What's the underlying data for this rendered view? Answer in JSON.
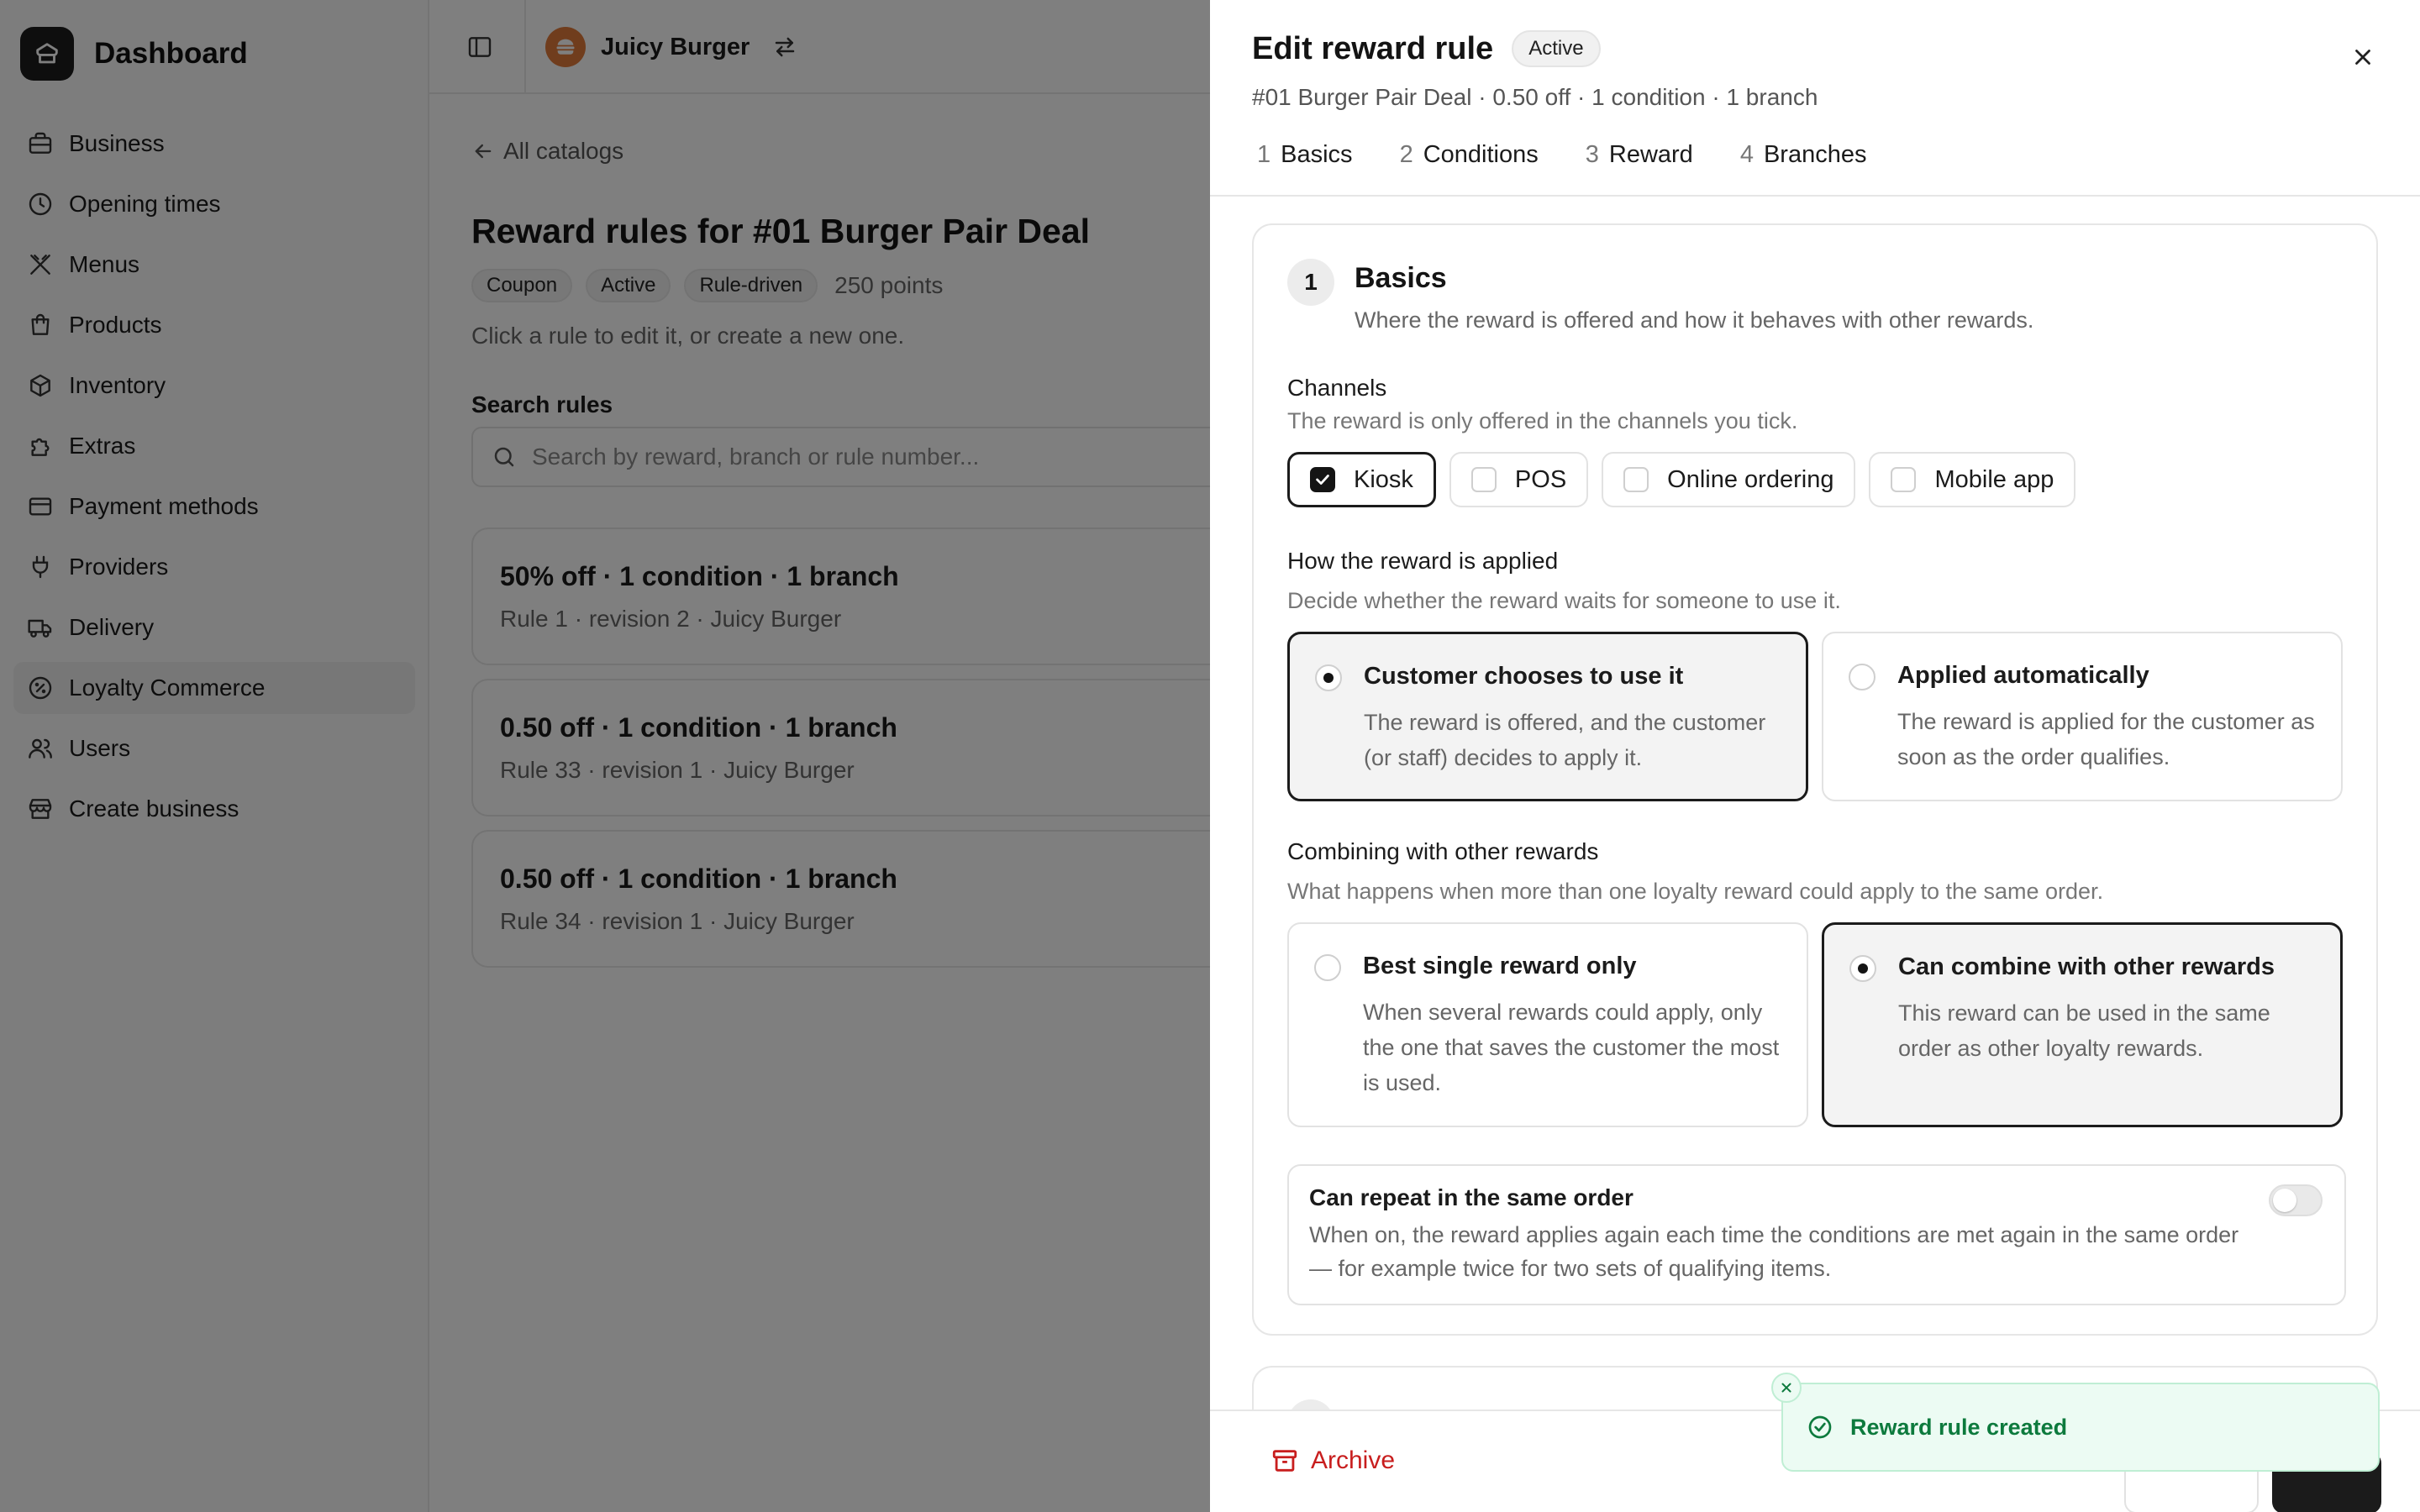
{
  "sidebar": {
    "brand": "Dashboard",
    "items": [
      {
        "label": "Business",
        "icon": "briefcase-icon"
      },
      {
        "label": "Opening times",
        "icon": "clock-icon"
      },
      {
        "label": "Menus",
        "icon": "utensils-icon"
      },
      {
        "label": "Products",
        "icon": "shopping-bag-icon"
      },
      {
        "label": "Inventory",
        "icon": "package-icon"
      },
      {
        "label": "Extras",
        "icon": "puzzle-icon"
      },
      {
        "label": "Payment methods",
        "icon": "credit-card-icon"
      },
      {
        "label": "Providers",
        "icon": "plug-icon"
      },
      {
        "label": "Delivery",
        "icon": "truck-icon"
      },
      {
        "label": "Loyalty Commerce",
        "icon": "badge-percent-icon",
        "active": true
      },
      {
        "label": "Users",
        "icon": "users-icon"
      },
      {
        "label": "Create business",
        "icon": "store-icon"
      }
    ]
  },
  "topbar": {
    "business_name": "Juicy Burger"
  },
  "main": {
    "back_label": "All catalogs",
    "title": "Reward rules for #01 Burger Pair Deal",
    "badges": [
      "Coupon",
      "Active",
      "Rule-driven"
    ],
    "points": "250 points",
    "subtitle": "Click a rule to edit it, or create a new one.",
    "search_label": "Search rules",
    "search_placeholder": "Search by reward, branch or rule number...",
    "rules": [
      {
        "title": "50% off · 1 condition · 1 branch",
        "meta": "Rule 1 · revision 2 · Juicy Burger"
      },
      {
        "title": "0.50 off · 1 condition · 1 branch",
        "meta": "Rule 33 · revision 1 · Juicy Burger"
      },
      {
        "title": "0.50 off · 1 condition · 1 branch",
        "meta": "Rule 34 · revision 1 · Juicy Burger"
      }
    ]
  },
  "drawer": {
    "title": "Edit reward rule",
    "status": "Active",
    "subtitle": "#01 Burger Pair Deal · 0.50 off · 1 condition · 1 branch",
    "steps": [
      {
        "num": "1",
        "label": "Basics"
      },
      {
        "num": "2",
        "label": "Conditions"
      },
      {
        "num": "3",
        "label": "Reward"
      },
      {
        "num": "4",
        "label": "Branches"
      }
    ],
    "section": {
      "num": "1",
      "title": "Basics",
      "desc": "Where the reward is offered and how it behaves with other rewards.",
      "channels_label": "Channels",
      "channels_hint": "The reward is only offered in the channels you tick.",
      "channels": [
        {
          "label": "Kiosk",
          "checked": true
        },
        {
          "label": "POS",
          "checked": false
        },
        {
          "label": "Online ordering",
          "checked": false
        },
        {
          "label": "Mobile app",
          "checked": false
        }
      ],
      "applied_label": "How the reward is applied",
      "applied_hint": "Decide whether the reward waits for someone to use it.",
      "applied_options": [
        {
          "title": "Customer chooses to use it",
          "desc": "The reward is offered, and the customer (or staff) decides to apply it.",
          "selected": true
        },
        {
          "title": "Applied automatically",
          "desc": "The reward is applied for the customer as soon as the order qualifies.",
          "selected": false
        }
      ],
      "combine_label": "Combining with other rewards",
      "combine_hint": "What happens when more than one loyalty reward could apply to the same order.",
      "combine_options": [
        {
          "title": "Best single reward only",
          "desc": "When several rewards could apply, only the one that saves the customer the most is used.",
          "selected": false
        },
        {
          "title": "Can combine with other rewards",
          "desc": "This reward can be used in the same order as other loyalty rewards.",
          "selected": true
        }
      ],
      "repeat_title": "Can repeat in the same order",
      "repeat_desc": "When on, the reward applies again each time the conditions are met again in the same order — for example twice for two sets of qualifying items.",
      "repeat_on": false
    },
    "footer": {
      "archive_label": "Archive"
    }
  },
  "toast": {
    "message": "Reward rule created"
  },
  "colors": {
    "overlay": "#000000",
    "danger": "#c81e1e",
    "success": "#0d7a3d",
    "success_bg": "#ecfbf3",
    "avatar": "#e07a3a"
  }
}
